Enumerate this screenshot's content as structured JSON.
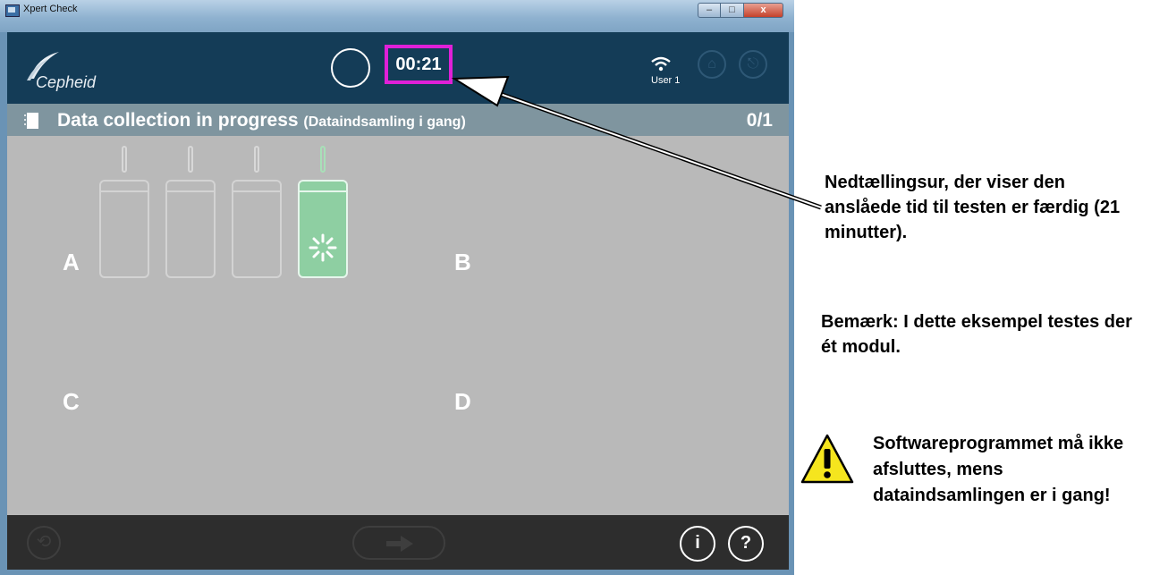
{
  "window": {
    "title": "Xpert Check",
    "minimize": "–",
    "maximize": "□",
    "close": "x"
  },
  "header": {
    "logo_text": "Cepheid",
    "timer": "00:21",
    "user": "User 1",
    "icons": [
      "wifi-icon",
      "home-icon",
      "exit-icon"
    ]
  },
  "status": {
    "title": "Data collection in progress",
    "subtitle": "(Dataindsamling i gang)",
    "count": "0/1"
  },
  "modules": {
    "letters": {
      "a": "A",
      "b": "B",
      "c": "C",
      "d": "D"
    },
    "active_index": 4,
    "active_color": "#8ecfa2"
  },
  "footer": {
    "info": "i",
    "help": "?"
  },
  "annotations": {
    "timer": "Nedtællingsur, der viser den anslåede tid til testen er færdig (21 minutter).",
    "note": "Bemærk: I dette eksempel testes der ét modul.",
    "warning": "Softwareprogrammet må ikke afsluttes, mens dataindsamlingen er i gang!"
  },
  "colors": {
    "header": "#143c57",
    "highlight": "#e020d8",
    "statusbar": "#7f959f",
    "body": "#b9b9b9",
    "footer": "#2d2d2d"
  }
}
